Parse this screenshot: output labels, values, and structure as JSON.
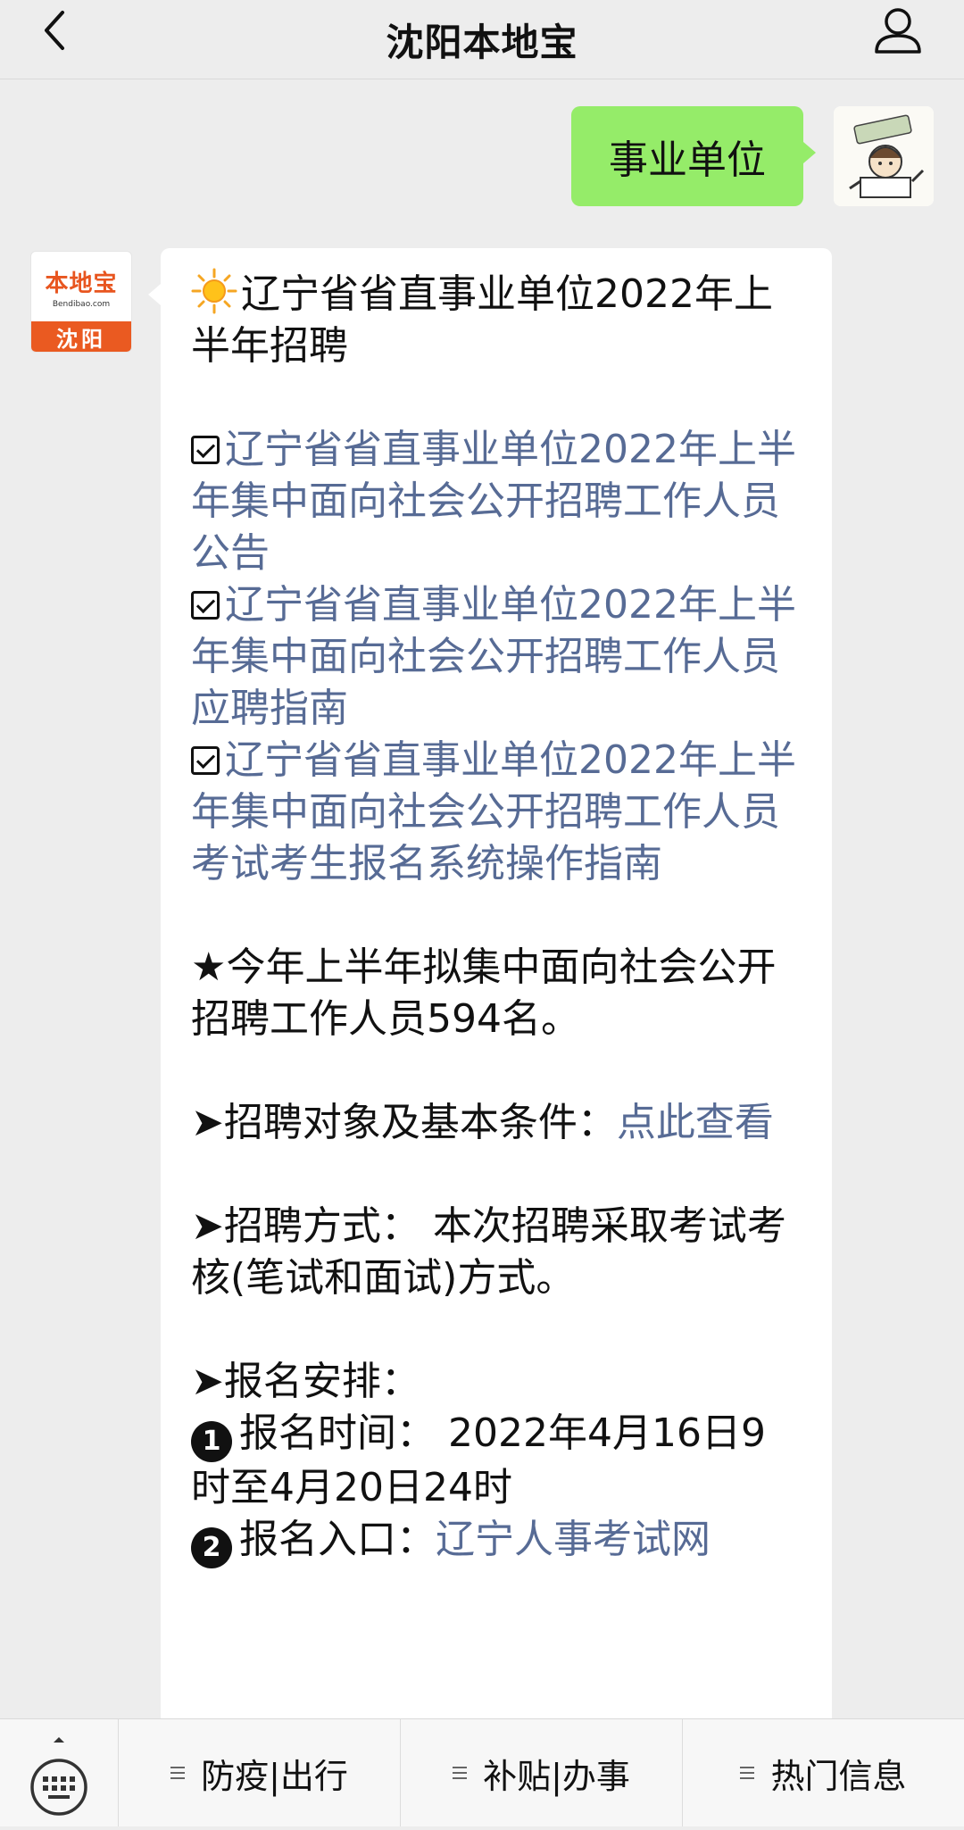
{
  "header": {
    "title": "沈阳本地宝"
  },
  "user_message": {
    "text": "事业单位"
  },
  "bot_avatar": {
    "main": "本地宝",
    "sub": "Bendibao.com",
    "city": "沈阳"
  },
  "bot_message": {
    "heading": "辽宁省省直事业单位2022年上半年招聘",
    "links": [
      "辽宁省省直事业单位2022年上半年集中面向社会公开招聘工作人员公告",
      "辽宁省省直事业单位2022年上半年集中面向社会公开招聘工作人员应聘指南",
      "辽宁省省直事业单位2022年上半年集中面向社会公开招聘工作人员考试考生报名系统操作指南"
    ],
    "star_prefix": "★",
    "star_text": "今年上半年拟集中面向社会公开招聘工作人员594名。",
    "arrow": "➤",
    "target_label": "招聘对象及基本条件：",
    "target_link": "点此查看",
    "method_label": "招聘方式：",
    "method_text": "本次招聘采取考试考核(笔试和面试)方式。",
    "signup_label": "报名安排：",
    "item1_num": "1",
    "item1_label": "报名时间：",
    "item1_text": "2022年4月16日9时至4月20日24时",
    "item2_num": "2",
    "item2_label": "报名入口：",
    "item2_link": "辽宁人事考试网"
  },
  "bottom_menu": {
    "items": [
      "防疫|出行",
      "补贴|办事",
      "热门信息"
    ]
  },
  "icons": {
    "back": "chevron-left-icon",
    "profile": "person-icon",
    "keyboard": "keyboard-icon",
    "menu": "menu-lines-icon"
  },
  "colors": {
    "user_bubble": "#95ec69",
    "link": "#576b95",
    "background": "#ededed"
  }
}
